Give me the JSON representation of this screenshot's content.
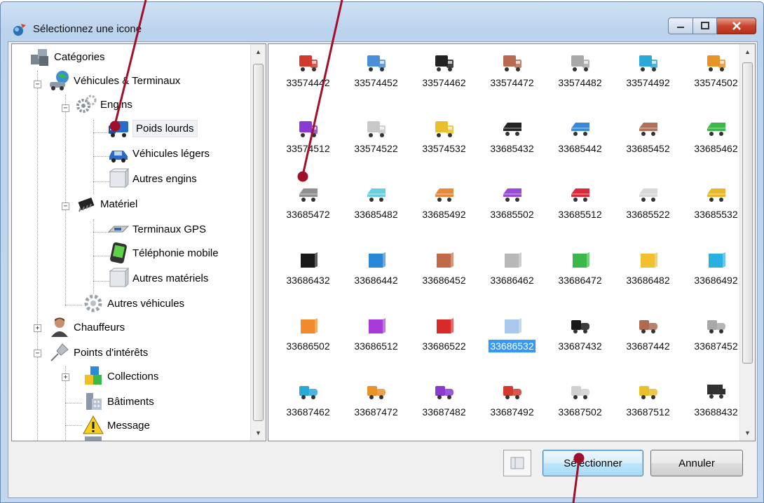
{
  "window": {
    "title": "Sélectionnez une icone"
  },
  "tree": {
    "items": [
      {
        "label": "Catégories",
        "icon": "categories-cubes-icon"
      },
      {
        "label": "Véhicules & Terminaux",
        "icon": "globe-car-icon"
      },
      {
        "label": "Engins",
        "icon": "gears-icon"
      },
      {
        "label": "Poids lourds",
        "icon": "truck-icon"
      },
      {
        "label": "Véhicules légers",
        "icon": "car-icon"
      },
      {
        "label": "Autres engins",
        "icon": "cube-icon"
      },
      {
        "label": "Matériel",
        "icon": "chip-icon"
      },
      {
        "label": "Terminaux GPS",
        "icon": "gps-device-icon"
      },
      {
        "label": "Téléphonie mobile",
        "icon": "mobile-phone-icon"
      },
      {
        "label": "Autres matériels",
        "icon": "cube-icon"
      },
      {
        "label": "Autres véhicules",
        "icon": "gear-icon"
      },
      {
        "label": "Chauffeurs",
        "icon": "driver-person-icon"
      },
      {
        "label": "Points d'intérêts",
        "icon": "pushpin-icon"
      },
      {
        "label": "Collections",
        "icon": "collection-cubes-icon"
      },
      {
        "label": "Bâtiments",
        "icon": "buildings-icon"
      },
      {
        "label": "Message",
        "icon": "warning-icon"
      }
    ],
    "selected": "Poids lourds"
  },
  "icons": [
    {
      "code": "33574442",
      "kind": "truck",
      "color": "#d23a2e"
    },
    {
      "code": "33574452",
      "kind": "truck",
      "color": "#4a8fd8"
    },
    {
      "code": "33574462",
      "kind": "truck",
      "color": "#222222"
    },
    {
      "code": "33574472",
      "kind": "truck",
      "color": "#b86a50"
    },
    {
      "code": "33574482",
      "kind": "truck",
      "color": "#a8a8a8"
    },
    {
      "code": "33574492",
      "kind": "truck",
      "color": "#2aa8d8"
    },
    {
      "code": "33574502",
      "kind": "truck",
      "color": "#e8922a"
    },
    {
      "code": "33574512",
      "kind": "truck",
      "color": "#8a3ad0"
    },
    {
      "code": "33574522",
      "kind": "truck",
      "color": "#c8c8c8"
    },
    {
      "code": "33574532",
      "kind": "truck",
      "color": "#e8c02a"
    },
    {
      "code": "33685432",
      "kind": "trailer",
      "color": "#222222"
    },
    {
      "code": "33685442",
      "kind": "trailer",
      "color": "#3a88d8"
    },
    {
      "code": "33685452",
      "kind": "trailer",
      "color": "#b0705a"
    },
    {
      "code": "33685462",
      "kind": "trailer",
      "color": "#3ab84a"
    },
    {
      "code": "33685472",
      "kind": "trailer",
      "color": "#909090"
    },
    {
      "code": "33685482",
      "kind": "trailer",
      "color": "#6ad0e0"
    },
    {
      "code": "33685492",
      "kind": "trailer",
      "color": "#e8883a"
    },
    {
      "code": "33685502",
      "kind": "trailer",
      "color": "#9a4ad8"
    },
    {
      "code": "33685512",
      "kind": "trailer",
      "color": "#d82a3a"
    },
    {
      "code": "33685522",
      "kind": "trailer",
      "color": "#d8d8d8"
    },
    {
      "code": "33685532",
      "kind": "trailer",
      "color": "#e8b82a"
    },
    {
      "code": "33686432",
      "kind": "box",
      "color": "#1a1a1a"
    },
    {
      "code": "33686442",
      "kind": "box",
      "color": "#2a88d8"
    },
    {
      "code": "33686452",
      "kind": "box",
      "color": "#c06a48"
    },
    {
      "code": "33686462",
      "kind": "box",
      "color": "#b8b8b8"
    },
    {
      "code": "33686472",
      "kind": "box",
      "color": "#3ab84a"
    },
    {
      "code": "33686482",
      "kind": "box",
      "color": "#f0c030"
    },
    {
      "code": "33686492",
      "kind": "box",
      "color": "#2ab0e0"
    },
    {
      "code": "33686502",
      "kind": "box",
      "color": "#f08a2a"
    },
    {
      "code": "33686512",
      "kind": "box",
      "color": "#a83ad8"
    },
    {
      "code": "33686522",
      "kind": "box",
      "color": "#d82a2a"
    },
    {
      "code": "33686532",
      "kind": "box",
      "color": "#a8c8ec"
    },
    {
      "code": "33687432",
      "kind": "van",
      "color": "#1a1a1a"
    },
    {
      "code": "33687442",
      "kind": "van",
      "color": "#b06a50"
    },
    {
      "code": "33687452",
      "kind": "van",
      "color": "#a8a8a8"
    },
    {
      "code": "33687462",
      "kind": "van",
      "color": "#2aa8d8"
    },
    {
      "code": "33687472",
      "kind": "van",
      "color": "#e8922a"
    },
    {
      "code": "33687482",
      "kind": "van",
      "color": "#8a3ad0"
    },
    {
      "code": "33687492",
      "kind": "van",
      "color": "#d23a2e"
    },
    {
      "code": "33687502",
      "kind": "van",
      "color": "#d0d0d0"
    },
    {
      "code": "33687512",
      "kind": "van",
      "color": "#e8c02a"
    },
    {
      "code": "33688432",
      "kind": "flatbed",
      "color": "#303030"
    }
  ],
  "selected_icon": "33686532",
  "buttons": {
    "select": "Sélectionner",
    "cancel": "Annuler"
  },
  "colors": {
    "selection": "#3399ff",
    "annotation": "#a0102a"
  }
}
